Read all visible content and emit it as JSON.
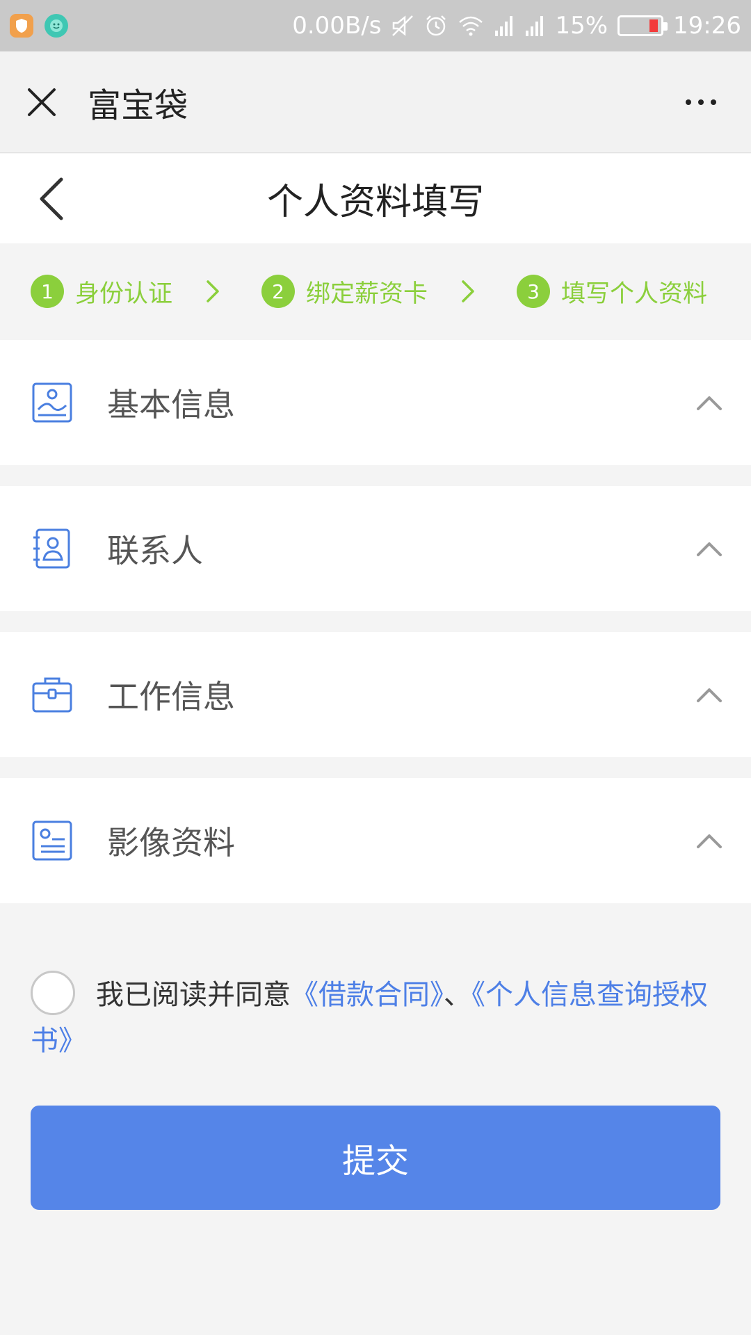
{
  "status_bar": {
    "network_speed": "0.00B/s",
    "battery_percent": "15%",
    "time": "19:26",
    "battery_level": 0.15,
    "colors": {
      "battery_low": "#f23b3b"
    }
  },
  "nav": {
    "title": "富宝袋"
  },
  "page": {
    "title": "个人资料填写"
  },
  "steps": [
    {
      "number": "1",
      "label": "身份认证"
    },
    {
      "number": "2",
      "label": "绑定薪资卡"
    },
    {
      "number": "3",
      "label": "填写个人资料"
    }
  ],
  "sections": [
    {
      "label": "基本信息",
      "icon": "image-icon"
    },
    {
      "label": "联系人",
      "icon": "contact-book-icon"
    },
    {
      "label": "工作信息",
      "icon": "briefcase-icon"
    },
    {
      "label": "影像资料",
      "icon": "id-card-icon"
    }
  ],
  "agreement": {
    "prefix": "我已阅读并同意",
    "link1": "《借款合同》",
    "separator": "、",
    "link2": "《个人信息查询授权书》"
  },
  "submit": {
    "label": "提交"
  },
  "colors": {
    "step_green": "#8bcf3c",
    "primary_blue": "#5585e8",
    "link_blue": "#4d7fe6",
    "icon_blue": "#4a7fe0"
  }
}
